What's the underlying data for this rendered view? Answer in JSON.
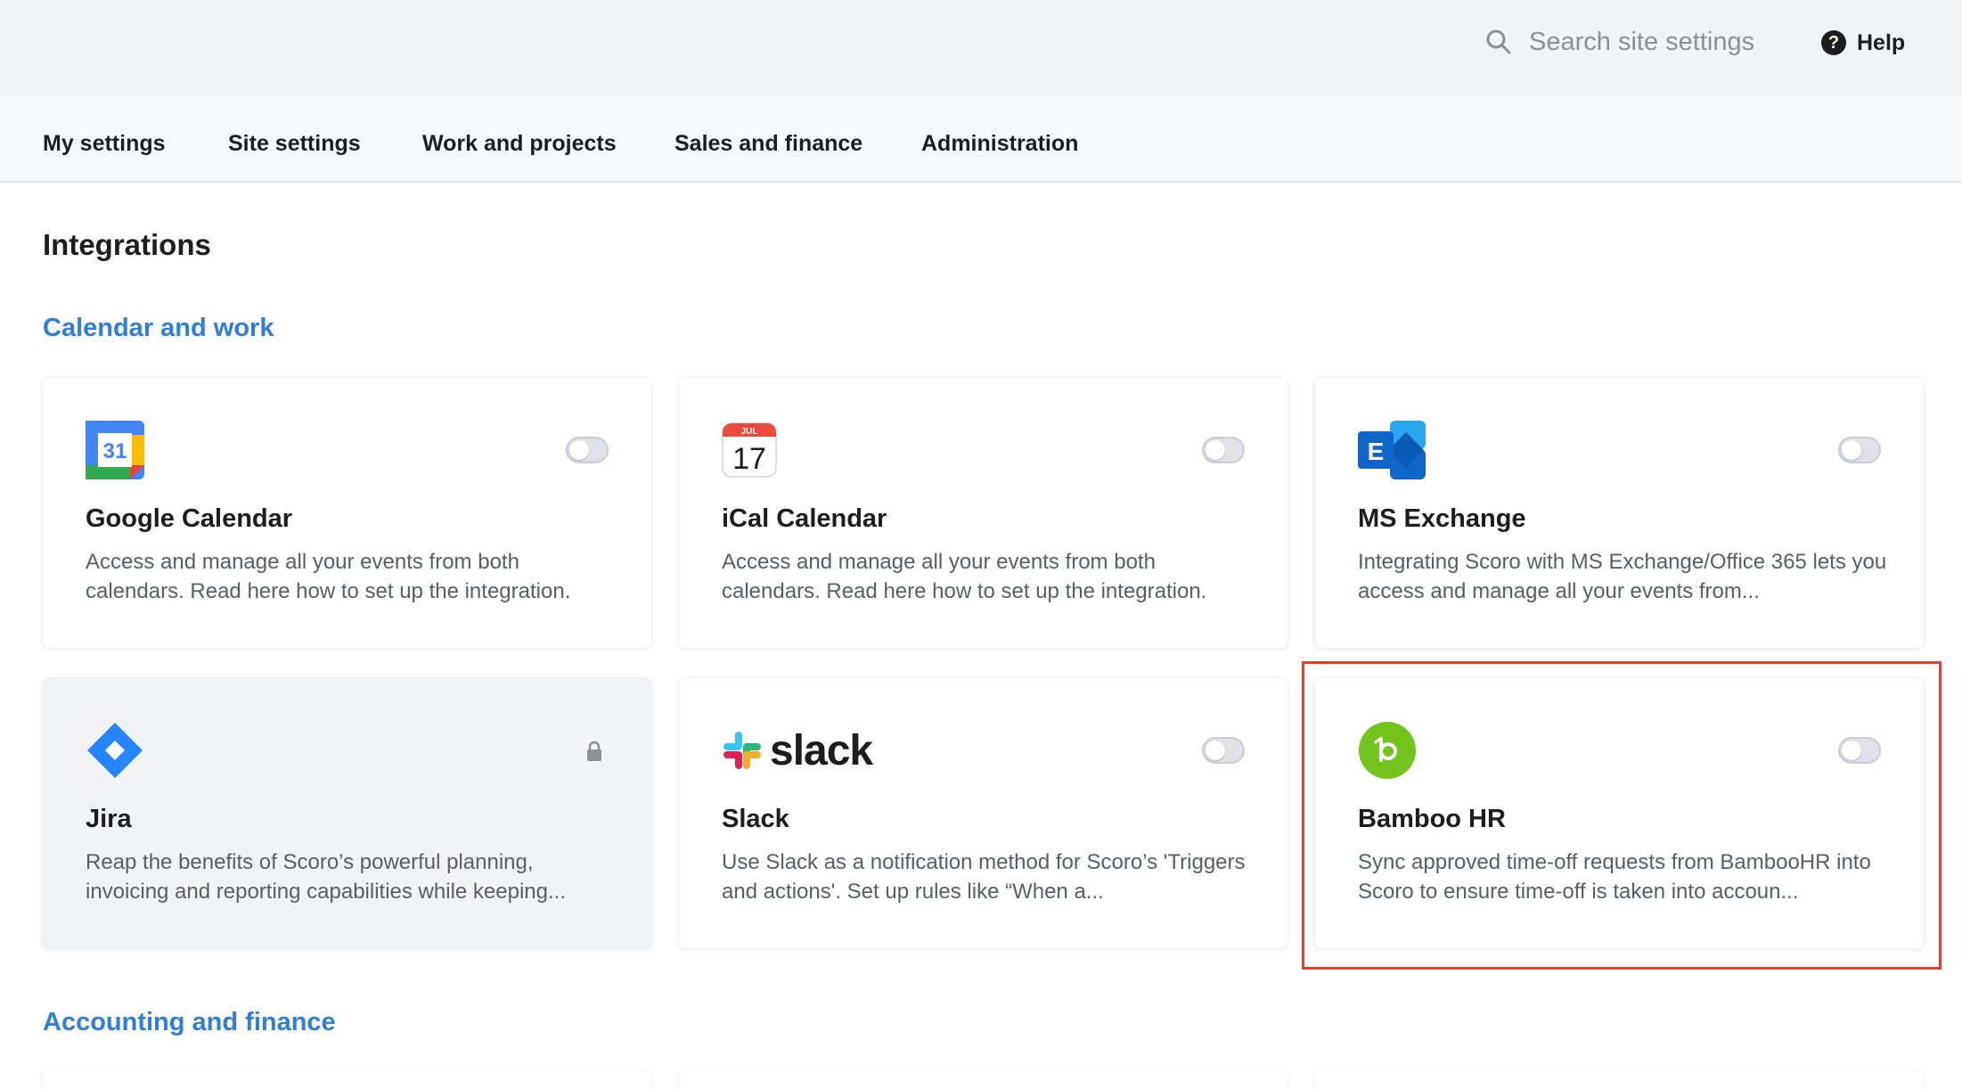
{
  "search": {
    "placeholder": "Search site settings"
  },
  "help": {
    "label": "Help"
  },
  "nav": {
    "items": [
      {
        "label": "My settings"
      },
      {
        "label": "Site settings"
      },
      {
        "label": "Work and projects"
      },
      {
        "label": "Sales and finance"
      },
      {
        "label": "Administration"
      }
    ]
  },
  "page": {
    "title": "Integrations"
  },
  "sections": [
    {
      "title": "Calendar and work"
    },
    {
      "title": "Accounting and finance"
    }
  ],
  "cards": [
    {
      "name": "Google Calendar",
      "description": "Access and manage all your events from both calendars. Read here how to set up the integration.",
      "logo": "google-calendar-logo",
      "logo_text": "31",
      "enabled": false
    },
    {
      "name": "iCal Calendar",
      "description": "Access and manage all your events from both calendars. Read here how to set up the integration.",
      "logo": "ical-calendar-logo",
      "logo_month": "JUL",
      "logo_day": "17",
      "enabled": false
    },
    {
      "name": "MS Exchange",
      "description": "Integrating Scoro with MS Exchange/Office 365 lets you access and manage all your events from...",
      "logo": "ms-exchange-logo",
      "logo_text": "E",
      "enabled": false
    },
    {
      "name": "Jira",
      "description": "Reap the benefits of Scoro’s powerful planning, invoicing and reporting capabilities while keeping...",
      "logo": "jira-logo",
      "locked": true
    },
    {
      "name": "Slack",
      "description": "Use Slack as a notification method for Scoro’s 'Triggers and actions'. Set up rules like “When a...",
      "logo": "slack-logo",
      "logo_text": "slack",
      "enabled": false
    },
    {
      "name": "Bamboo HR",
      "description": "Sync approved time-off requests from BambooHR into Scoro to ensure time-off is taken into accoun...",
      "logo": "bamboo-hr-logo",
      "enabled": false,
      "highlighted": true
    }
  ],
  "colors": {
    "accent_blue": "#2f7fd6",
    "highlight_red": "#e0402b",
    "bamboo_green": "#73c41d",
    "jira_blue": "#2684ff",
    "exchange_blue": "#1066c8"
  }
}
